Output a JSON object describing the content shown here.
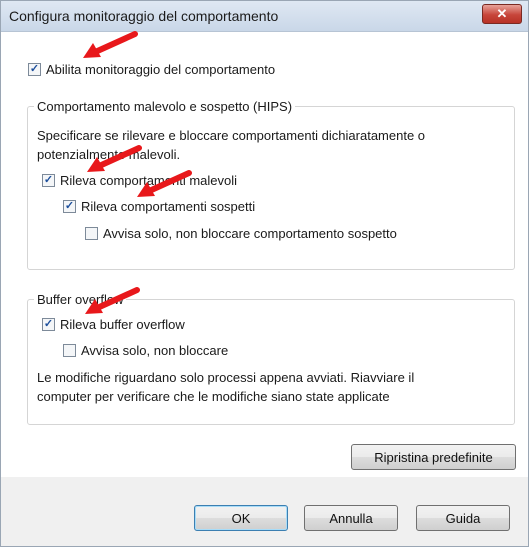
{
  "window": {
    "title": "Configura monitoraggio del comportamento",
    "close_glyph": "✕"
  },
  "main_checkbox": {
    "label": "Abilita monitoraggio del comportamento",
    "checked": true
  },
  "hips_group": {
    "legend": "Comportamento malevolo e sospetto (HIPS)",
    "description_line1": "Specificare se rilevare e bloccare comportamenti dichiaratamente o",
    "description_line2": "potenzialmente malevoli.",
    "items": [
      {
        "label": "Rileva comportamenti malevoli",
        "checked": true
      },
      {
        "label": "Rileva comportamenti sospetti",
        "checked": true
      },
      {
        "label": "Avvisa solo, non bloccare comportamento sospetto",
        "checked": false
      }
    ]
  },
  "buffer_group": {
    "legend": "Buffer overflow",
    "items": [
      {
        "label": "Rileva buffer overflow",
        "checked": true
      },
      {
        "label": "Avvisa solo, non bloccare",
        "checked": false
      }
    ],
    "note_line1": "Le modifiche riguardano solo processi appena avviati. Riavviare il",
    "note_line2": "computer per verificare che le modifiche siano state applicate"
  },
  "buttons": {
    "restore": "Ripristina predefinite",
    "ok": "OK",
    "cancel": "Annulla",
    "help": "Guida"
  },
  "colors": {
    "annotation_arrow": "#e8181b",
    "check": "#1d4f9c"
  },
  "icons": {
    "check": "checkmark-icon",
    "close": "close-icon",
    "annotation": "red-arrow-annotation"
  }
}
